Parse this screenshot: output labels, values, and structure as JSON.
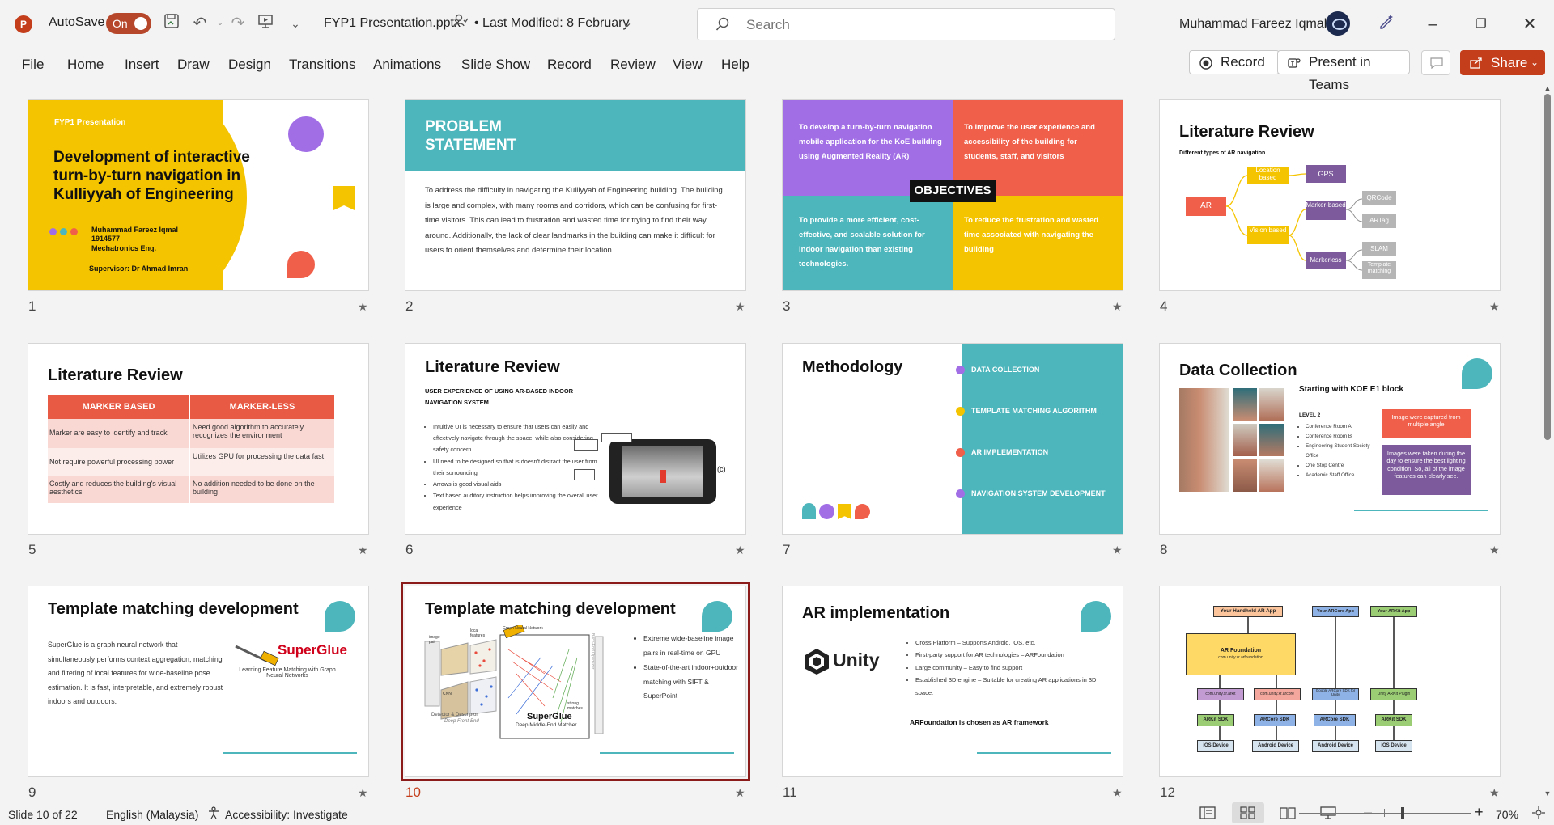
{
  "app": {
    "autosave_label": "AutoSave",
    "autosave_state": "On",
    "document_name": "FYP1 Presentation.pptx",
    "last_modified": "• Last Modified: 8 February",
    "search_placeholder": "Search",
    "user_name": "Muhammad Fareez Iqmal"
  },
  "ribbon": {
    "tabs": [
      "File",
      "Home",
      "Insert",
      "Draw",
      "Design",
      "Transitions",
      "Animations",
      "Slide Show",
      "Record",
      "Review",
      "View",
      "Help"
    ],
    "record_label": "Record",
    "present_label": "Present in Teams",
    "share_label": "Share"
  },
  "slides": [
    {
      "number": "1",
      "kicker": "FYP1 Presentation",
      "title": "Development of interactive turn-by-turn navigation in Kulliyyah of Engineering",
      "author": "Muhammad Fareez Iqmal",
      "id": "1914577",
      "program": "Mechatronics Eng.",
      "supervisor": "Supervisor: Dr Ahmad Imran"
    },
    {
      "number": "2",
      "title": "PROBLEM STATEMENT",
      "body": "To address the difficulty in navigating the Kulliyyah of Engineering building. The building is large and complex, with many rooms and corridors, which can be confusing for first-time visitors. This can lead to frustration and wasted time for trying to find their way around. Additionally, the lack of clear landmarks in the building can make it difficult for users to orient themselves and determine their location."
    },
    {
      "number": "3",
      "title": "OBJECTIVES",
      "q1": "To develop a turn-by-turn navigation mobile application for the KoE building using Augmented Reality (AR)",
      "q2": "To improve the user experience and accessibility of the building for students, staff, and visitors",
      "q3": "To provide a more efficient, cost-effective, and scalable solution for indoor navigation than existing technologies.",
      "q4": "To reduce the frustration and wasted time associated with navigating the building"
    },
    {
      "number": "4",
      "title": "Literature Review",
      "subtitle": "Different types of AR navigation",
      "nodes": {
        "ar": "AR",
        "location": "Location based",
        "vision": "Vision based",
        "gps": "GPS",
        "marker": "Marker-based",
        "markerless": "Markerless",
        "qrcode": "QRCode",
        "artag": "ARTag",
        "slam": "SLAM",
        "template": "Template matching"
      }
    },
    {
      "number": "5",
      "title": "Literature Review",
      "headers": [
        "MARKER BASED",
        "MARKER-LESS"
      ],
      "rows": [
        [
          "Marker are easy to identify and track",
          "Need good algorithm to accurately recognizes the environment"
        ],
        [
          "Not require powerful processing power",
          "Utilizes GPU for processing the data fast"
        ],
        [
          "Costly and reduces the building's visual aesthetics",
          "No addition needed to be done on the building"
        ]
      ]
    },
    {
      "number": "6",
      "title": "Literature Review",
      "subtitle": "USER EXPERIENCE OF USING AR-BASED INDOOR NAVIGATION SYSTEM",
      "bullets": [
        "Intuitive UI is necessary to ensure that users can easily and effectively navigate through the space, while also considering safety concern",
        "UI need to be designed so that is doesn't distract the user from their surrounding",
        "Arrows is good visual aids",
        "Text based auditory instruction helps improving the overall user experience"
      ],
      "figure_label": "(c)"
    },
    {
      "number": "7",
      "title": "Methodology",
      "items": [
        "DATA COLLECTION",
        "TEMPLATE MATCHING ALGORITHM",
        "AR IMPLEMENTATION",
        "NAVIGATION SYSTEM DEVELOPMENT"
      ]
    },
    {
      "number": "8",
      "title": "Data Collection",
      "subtitle": "Starting with KOE E1 block",
      "level": "LEVEL 2",
      "rooms": [
        "Conference Room A",
        "Conference Room B",
        "Engineering Student Society Office",
        "One Stop Centre",
        "Academic Staff Office"
      ],
      "note1": "Image were captured from multiple angle",
      "note2": "Images were taken during the day to ensure the best lighting condition. So, all of the image features can clearly see."
    },
    {
      "number": "9",
      "title": "Template matching development",
      "body": "SuperGlue is a graph neural network that simultaneously performs context aggregation, matching and filtering of local features for wide-baseline pose estimation. It is fast, interpretable, and extremely robust indoors and outdoors.",
      "logo": "SuperGlue",
      "logo_caption": "Learning Feature Matching with Graph Neural Networks"
    },
    {
      "number": "10",
      "title": "Template matching development",
      "bullets": [
        "Extreme wide-baseline image pairs in real-time on GPU",
        "State-of-the-art indoor+outdoor matching with SIFT & SuperPoint"
      ],
      "fig_labels": {
        "image_pair": "image pair",
        "local_features": "local features",
        "gnn": "Graph Neural Network",
        "cnn": "CNN",
        "detector": "Detector & Descriptor",
        "frontend": "Deep Front-End",
        "superglue": "SuperGlue",
        "middle": "Deep Middle-End Matcher",
        "optimizer": "Back-End Optimizer",
        "strong": "strong matches"
      }
    },
    {
      "number": "11",
      "title": "AR implementation",
      "logo": "Unity",
      "bullets": [
        "Cross Platform – Supports Android, iOS, etc.",
        "First-party support for AR technologies – ARFoundation",
        "Large community – Easy to find support",
        "Established 3D engine – Suitable for creating AR applications in 3D space."
      ],
      "conclusion": "ARFoundation is chosen as AR framework"
    },
    {
      "number": "12",
      "boxes": {
        "handheld": "Your Handheld AR App",
        "arcore_app": "Your ARCore App",
        "arkit_app": "Your ARKit App",
        "foundation": "AR Foundation",
        "foundation_pkg": "com.unity.xr.arfoundation",
        "arkit_pkg": "com.unity.xr.arkit",
        "arcore_pkg": "com.unity.xr.arcore",
        "google_sdk": "Google ARCore SDK for Unity",
        "arkit_plugin": "Unity ARKit Plugin",
        "arkit_sdk": "ARKit SDK",
        "arcore_sdk": "ARCore SDK",
        "ios": "iOS Device",
        "android": "Android Device"
      }
    }
  ],
  "status": {
    "slide_position": "Slide 10 of 22",
    "language": "English (Malaysia)",
    "accessibility": "Accessibility: Investigate",
    "zoom": "70%"
  },
  "colors": {
    "brand": "#c43e1c",
    "selection": "#8b1a1a",
    "teal": "#4db6bc",
    "yellow": "#f5c400",
    "purple": "#a16ee6",
    "coral": "#ef5f4a"
  }
}
